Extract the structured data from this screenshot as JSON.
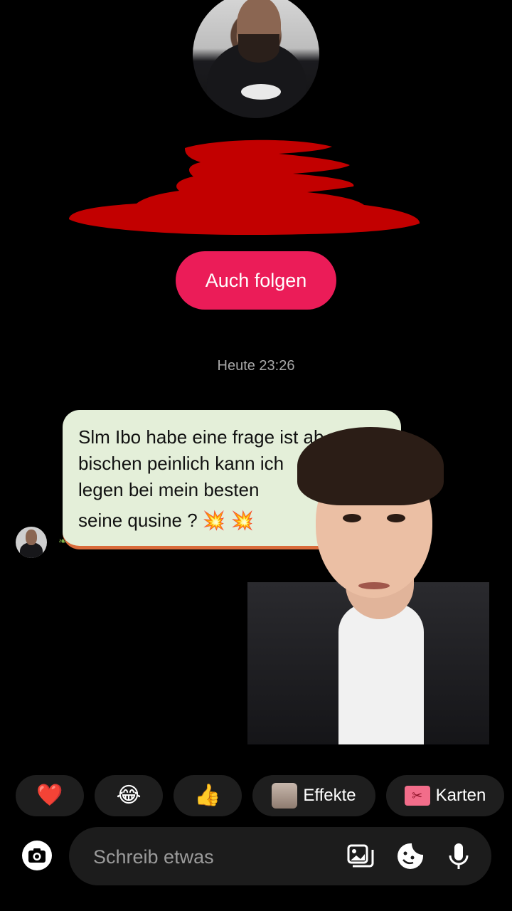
{
  "profile": {
    "follow_button_label": "Auch folgen"
  },
  "chat": {
    "timestamp": "Heute 23:26",
    "message": {
      "lines": [
        "Slm Ibo habe eine frage ist ab",
        "bischen peinlich kann ich",
        "legen bei mein besten",
        "seine qusine ? 💥 💥"
      ]
    }
  },
  "quick_reactions": {
    "heart": "❤️",
    "laugh": "😂",
    "thumbs_up": "👍",
    "effects_label": "Effekte",
    "cards_label": "Karten"
  },
  "composer": {
    "placeholder": "Schreib etwas"
  },
  "colors": {
    "follow_button": "#eb1c58",
    "bubble": "#e4efd9",
    "redaction": "#c20000"
  }
}
